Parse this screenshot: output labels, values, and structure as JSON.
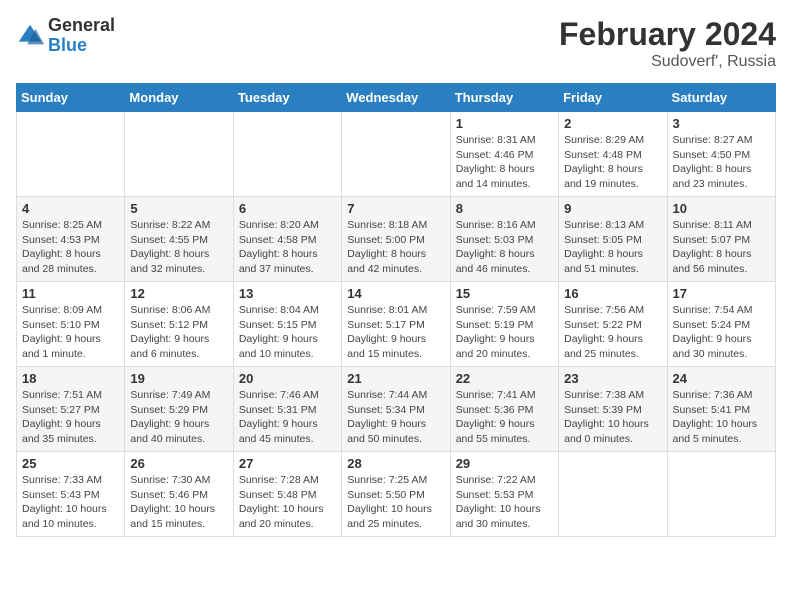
{
  "header": {
    "logo_general": "General",
    "logo_blue": "Blue",
    "main_title": "February 2024",
    "subtitle": "Sudoverf', Russia"
  },
  "days_of_week": [
    "Sunday",
    "Monday",
    "Tuesday",
    "Wednesday",
    "Thursday",
    "Friday",
    "Saturday"
  ],
  "weeks": [
    [
      {
        "day": "",
        "info": ""
      },
      {
        "day": "",
        "info": ""
      },
      {
        "day": "",
        "info": ""
      },
      {
        "day": "",
        "info": ""
      },
      {
        "day": "1",
        "info": "Sunrise: 8:31 AM\nSunset: 4:46 PM\nDaylight: 8 hours\nand 14 minutes."
      },
      {
        "day": "2",
        "info": "Sunrise: 8:29 AM\nSunset: 4:48 PM\nDaylight: 8 hours\nand 19 minutes."
      },
      {
        "day": "3",
        "info": "Sunrise: 8:27 AM\nSunset: 4:50 PM\nDaylight: 8 hours\nand 23 minutes."
      }
    ],
    [
      {
        "day": "4",
        "info": "Sunrise: 8:25 AM\nSunset: 4:53 PM\nDaylight: 8 hours\nand 28 minutes."
      },
      {
        "day": "5",
        "info": "Sunrise: 8:22 AM\nSunset: 4:55 PM\nDaylight: 8 hours\nand 32 minutes."
      },
      {
        "day": "6",
        "info": "Sunrise: 8:20 AM\nSunset: 4:58 PM\nDaylight: 8 hours\nand 37 minutes."
      },
      {
        "day": "7",
        "info": "Sunrise: 8:18 AM\nSunset: 5:00 PM\nDaylight: 8 hours\nand 42 minutes."
      },
      {
        "day": "8",
        "info": "Sunrise: 8:16 AM\nSunset: 5:03 PM\nDaylight: 8 hours\nand 46 minutes."
      },
      {
        "day": "9",
        "info": "Sunrise: 8:13 AM\nSunset: 5:05 PM\nDaylight: 8 hours\nand 51 minutes."
      },
      {
        "day": "10",
        "info": "Sunrise: 8:11 AM\nSunset: 5:07 PM\nDaylight: 8 hours\nand 56 minutes."
      }
    ],
    [
      {
        "day": "11",
        "info": "Sunrise: 8:09 AM\nSunset: 5:10 PM\nDaylight: 9 hours\nand 1 minute."
      },
      {
        "day": "12",
        "info": "Sunrise: 8:06 AM\nSunset: 5:12 PM\nDaylight: 9 hours\nand 6 minutes."
      },
      {
        "day": "13",
        "info": "Sunrise: 8:04 AM\nSunset: 5:15 PM\nDaylight: 9 hours\nand 10 minutes."
      },
      {
        "day": "14",
        "info": "Sunrise: 8:01 AM\nSunset: 5:17 PM\nDaylight: 9 hours\nand 15 minutes."
      },
      {
        "day": "15",
        "info": "Sunrise: 7:59 AM\nSunset: 5:19 PM\nDaylight: 9 hours\nand 20 minutes."
      },
      {
        "day": "16",
        "info": "Sunrise: 7:56 AM\nSunset: 5:22 PM\nDaylight: 9 hours\nand 25 minutes."
      },
      {
        "day": "17",
        "info": "Sunrise: 7:54 AM\nSunset: 5:24 PM\nDaylight: 9 hours\nand 30 minutes."
      }
    ],
    [
      {
        "day": "18",
        "info": "Sunrise: 7:51 AM\nSunset: 5:27 PM\nDaylight: 9 hours\nand 35 minutes."
      },
      {
        "day": "19",
        "info": "Sunrise: 7:49 AM\nSunset: 5:29 PM\nDaylight: 9 hours\nand 40 minutes."
      },
      {
        "day": "20",
        "info": "Sunrise: 7:46 AM\nSunset: 5:31 PM\nDaylight: 9 hours\nand 45 minutes."
      },
      {
        "day": "21",
        "info": "Sunrise: 7:44 AM\nSunset: 5:34 PM\nDaylight: 9 hours\nand 50 minutes."
      },
      {
        "day": "22",
        "info": "Sunrise: 7:41 AM\nSunset: 5:36 PM\nDaylight: 9 hours\nand 55 minutes."
      },
      {
        "day": "23",
        "info": "Sunrise: 7:38 AM\nSunset: 5:39 PM\nDaylight: 10 hours\nand 0 minutes."
      },
      {
        "day": "24",
        "info": "Sunrise: 7:36 AM\nSunset: 5:41 PM\nDaylight: 10 hours\nand 5 minutes."
      }
    ],
    [
      {
        "day": "25",
        "info": "Sunrise: 7:33 AM\nSunset: 5:43 PM\nDaylight: 10 hours\nand 10 minutes."
      },
      {
        "day": "26",
        "info": "Sunrise: 7:30 AM\nSunset: 5:46 PM\nDaylight: 10 hours\nand 15 minutes."
      },
      {
        "day": "27",
        "info": "Sunrise: 7:28 AM\nSunset: 5:48 PM\nDaylight: 10 hours\nand 20 minutes."
      },
      {
        "day": "28",
        "info": "Sunrise: 7:25 AM\nSunset: 5:50 PM\nDaylight: 10 hours\nand 25 minutes."
      },
      {
        "day": "29",
        "info": "Sunrise: 7:22 AM\nSunset: 5:53 PM\nDaylight: 10 hours\nand 30 minutes."
      },
      {
        "day": "",
        "info": ""
      },
      {
        "day": "",
        "info": ""
      }
    ]
  ]
}
